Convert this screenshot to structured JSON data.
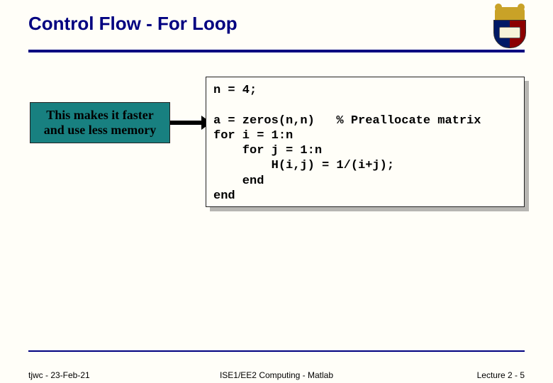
{
  "title": "Control Flow - For Loop",
  "callout": {
    "text": "This makes it faster and use less memory"
  },
  "code": {
    "line1": "n = 4;",
    "line2": "",
    "line3": "a = zeros(n,n)   % Preallocate matrix",
    "line4": "for i = 1:n",
    "line5": "    for j = 1:n",
    "line6": "        H(i,j) = 1/(i+j);",
    "line7": "    end",
    "line8": "end"
  },
  "footer": {
    "left": "tjwc - 23-Feb-21",
    "center": "ISE1/EE2 Computing - Matlab",
    "right": "Lecture 2 - 5"
  }
}
